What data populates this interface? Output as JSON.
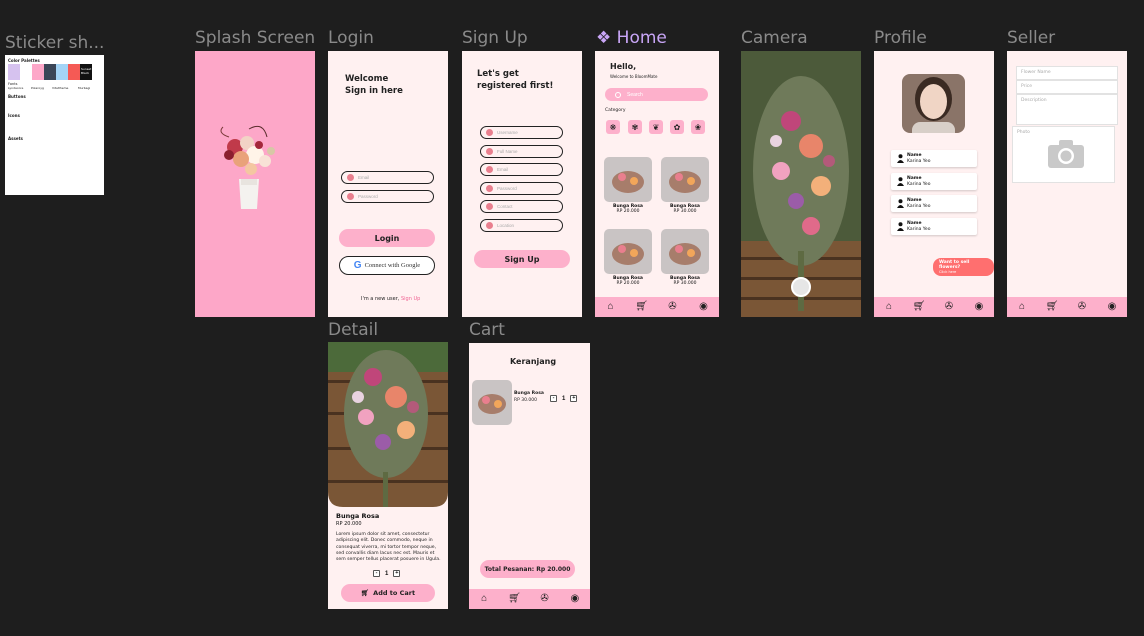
{
  "frames": {
    "sticker": "Sticker sh...",
    "splash": "Splash Screen",
    "login": "Login",
    "signup": "Sign Up",
    "home": "Home",
    "camera": "Camera",
    "profile": "Profile",
    "seller": "Seller",
    "detail": "Detail",
    "cart": "Cart"
  },
  "sticker": {
    "color_palette": "Color Palettes",
    "swatches": [
      "#d6c2ef",
      "#ffffff",
      "#fda7c8",
      "#3b4657",
      "#a4d4f6",
      "#f55a55",
      "#111111"
    ],
    "swatch_names": [
      "Lyndacore",
      "Polaroyg",
      "Vitaltheme",
      "Murbagi"
    ],
    "black_swatch_label": "Sunset Black",
    "fonts": "Fonts",
    "buttons": "Buttons",
    "icons": "Icons",
    "assets": "Assets"
  },
  "login": {
    "heading": "Welcome\nSign in here",
    "email_placeholder": "Email",
    "password_placeholder": "Password",
    "login_button": "Login",
    "google_button": "Connect with Google",
    "new_user_text": "I'm a new user,",
    "signup_link": "Sign Up"
  },
  "signup": {
    "heading": "Let's get\nregistered first!",
    "fields": [
      "Username",
      "Full Name",
      "Email",
      "Password",
      "Contact",
      "Location"
    ],
    "signup_button": "Sign Up"
  },
  "home": {
    "greeting": "Hello,",
    "welcome": "Welcome to BloomMate",
    "search_placeholder": "Search",
    "category_label": "Category",
    "categories": [
      "❋",
      "✾",
      "❦",
      "✿",
      "❀"
    ],
    "products": [
      {
        "name": "Bunga Rosa",
        "price": "RP 20.000"
      },
      {
        "name": "Bunga Rosa",
        "price": "RP 30.000"
      },
      {
        "name": "Bunga Rosa",
        "price": "RP 20.000"
      },
      {
        "name": "Bunga Rosa",
        "price": "RP 30.000"
      }
    ]
  },
  "nav": {
    "icons": [
      "home-icon",
      "cart-icon",
      "camera-shutter-icon",
      "profile-icon"
    ]
  },
  "profile": {
    "list": [
      {
        "name": "Name",
        "sub": "Karina Yeo"
      },
      {
        "name": "Name",
        "sub": "Karina Yeo"
      },
      {
        "name": "Name",
        "sub": "Karina Yeo"
      },
      {
        "name": "Name",
        "sub": "Karina Yeo"
      }
    ],
    "sell_button": "Want to sell flowers?",
    "sell_sub": "Click here"
  },
  "seller": {
    "flower_name": "Flower Name",
    "price": "Price",
    "description": "Description",
    "photo": "Photo"
  },
  "detail": {
    "title": "Bunga Rosa",
    "price": "RP 20.000",
    "description": "Lorem ipsum dolor sit amet, consectetur adipiscing elit. Donec commodo, neque in consequat viverra, mi tortor tempor neque, sed convallis diam lacus nec est. Mauris et sem semper tellus placerat posuere in Ugula.",
    "quantity": "1",
    "add_to_cart": "Add to Cart"
  },
  "cart": {
    "title": "Keranjang",
    "item_name": "Bunga Rosa",
    "item_price": "RP 30.000",
    "quantity": "1",
    "total": "Total Pesanan: Rp 20.000"
  },
  "colors": {
    "canvas": "#1e1e1e",
    "pink": "#fdb0cb",
    "frame_bg": "#fff1f1",
    "accent_red": "#ff6f6f",
    "link": "#f06292"
  }
}
